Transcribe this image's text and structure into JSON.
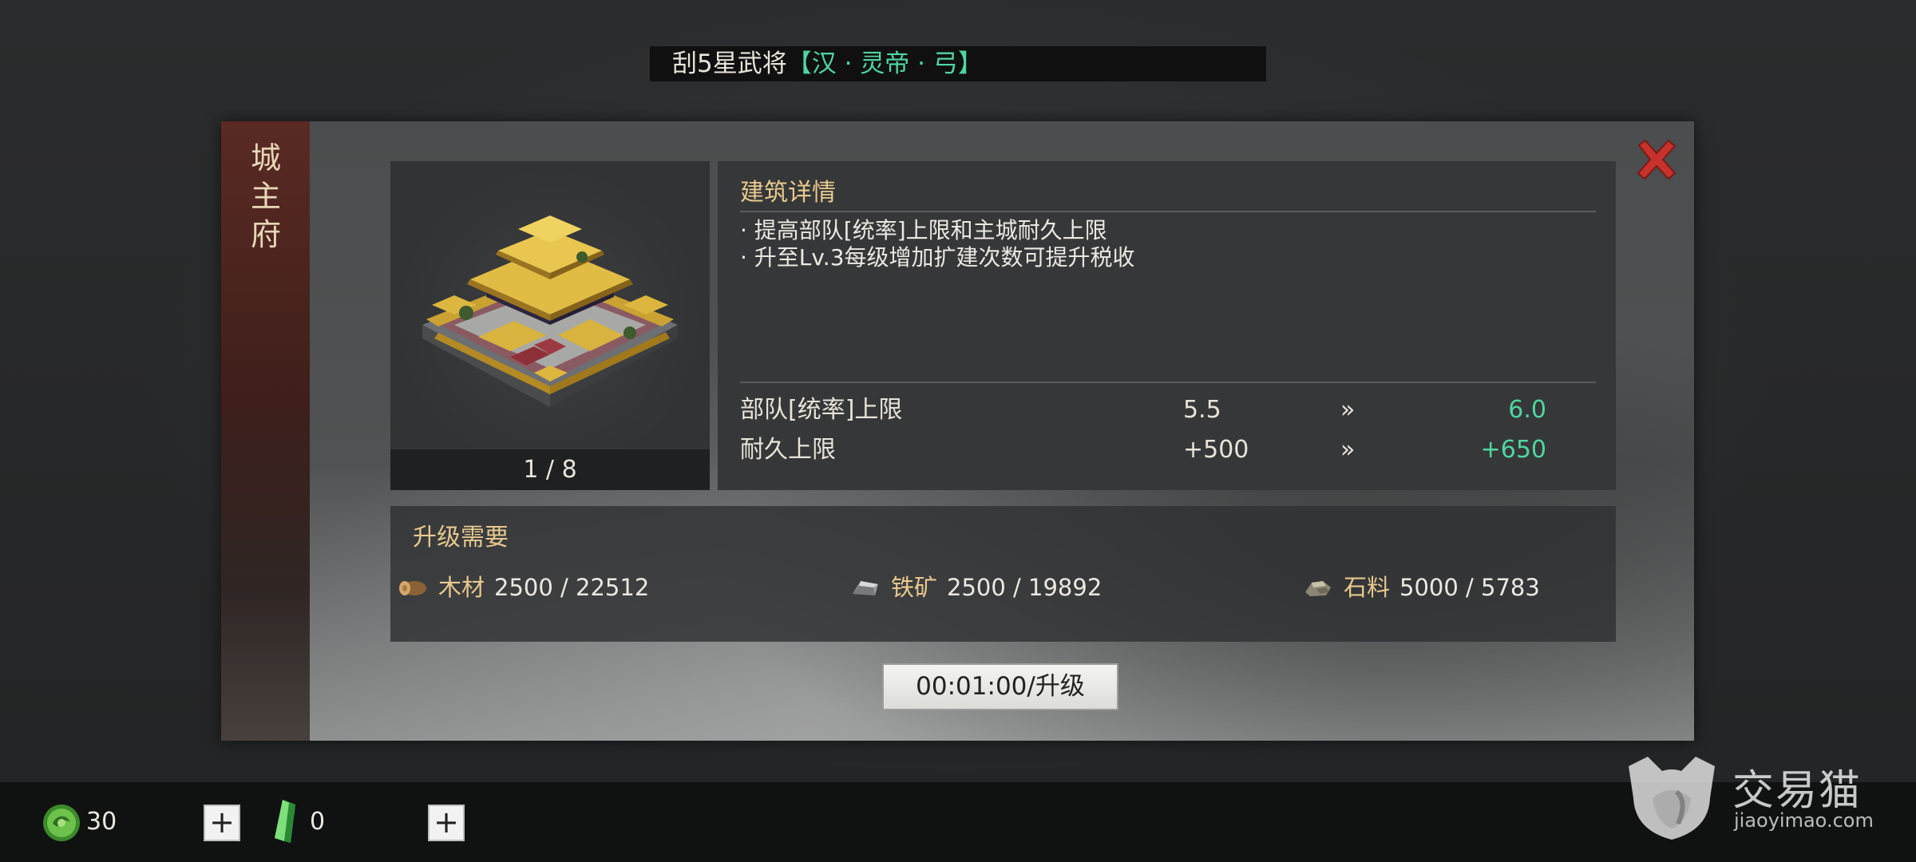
{
  "announcement": {
    "prefix": "刮5星武将",
    "highlight": "【汉 · 灵帝 · 弓】"
  },
  "modal": {
    "side_title": "城主府",
    "close_icon": "close-x-icon",
    "gallery": {
      "page_indicator": "1 / 8"
    },
    "details": {
      "title": "建筑详情",
      "descriptions": [
        "· 提高部队[统率]上限和主城耐久上限",
        "· 升至Lv.3每级增加扩建次数可提升税收"
      ],
      "stats": [
        {
          "label": "部队[统率]上限",
          "current": "5.5",
          "arrow": "»",
          "next": "6.0"
        },
        {
          "label": "耐久上限",
          "current": "+500",
          "arrow": "»",
          "next": "+650"
        }
      ]
    },
    "requirements": {
      "title": "升级需要",
      "items": [
        {
          "icon": "wood-icon",
          "name": "木材",
          "value": "2500 / 22512"
        },
        {
          "icon": "iron-ore-icon",
          "name": "铁矿",
          "value": "2500 / 19892"
        },
        {
          "icon": "stone-icon",
          "name": "石料",
          "value": "5000 / 5783"
        }
      ]
    },
    "upgrade_button": "00:01:00/升级"
  },
  "bottom_bar": {
    "jade": {
      "icon": "jade-coin-icon",
      "count": "30"
    },
    "gem": {
      "icon": "green-crystal-icon",
      "count": "0"
    }
  },
  "watermark": {
    "cn": "交易猫",
    "en": "jiaoyimao.com"
  },
  "colors": {
    "accent_green": "#4fd6a0",
    "label_gold": "#e7c98f",
    "close_red": "#c8322c",
    "side_tab": "#4a231f"
  }
}
